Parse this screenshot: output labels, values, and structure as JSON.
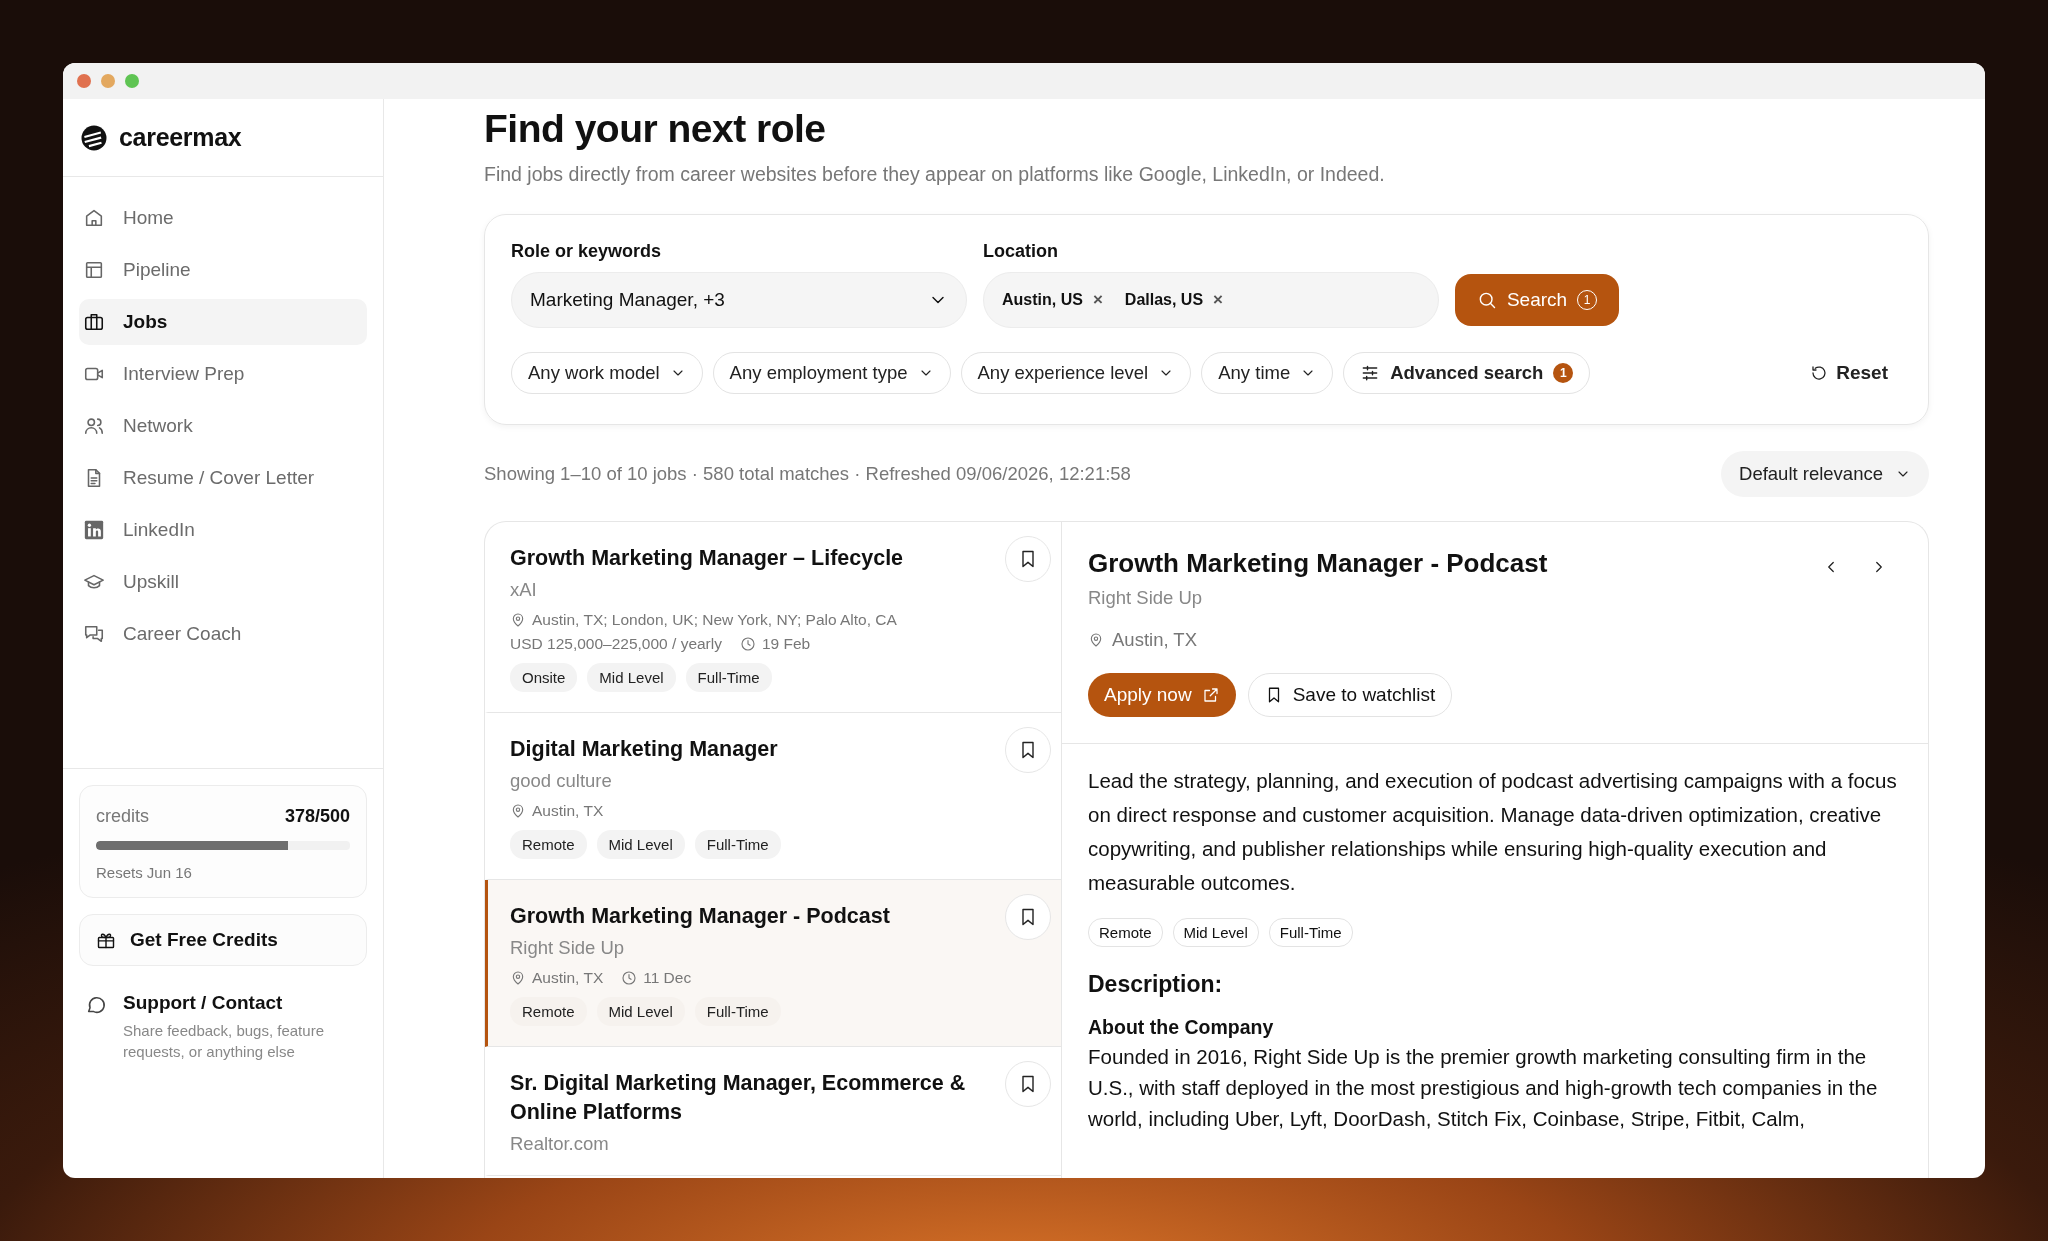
{
  "app": {
    "name": "careermax"
  },
  "nav": [
    {
      "label": "Home",
      "selected": false
    },
    {
      "label": "Pipeline",
      "selected": false
    },
    {
      "label": "Jobs",
      "selected": true
    },
    {
      "label": "Interview Prep",
      "selected": false
    },
    {
      "label": "Network",
      "selected": false
    },
    {
      "label": "Resume / Cover Letter",
      "selected": false
    },
    {
      "label": "LinkedIn",
      "selected": false
    },
    {
      "label": "Upskill",
      "selected": false
    },
    {
      "label": "Career Coach",
      "selected": false
    }
  ],
  "credits": {
    "label": "credits",
    "value": "378/500",
    "level": 0.756,
    "reset": "Resets Jun 16"
  },
  "free_credits": "Get Free Credits",
  "support": {
    "title": "Support / Contact",
    "text": "Share feedback, bugs, feature requests, or anything else"
  },
  "page": {
    "title": "Find your next role",
    "subtitle": "Find jobs directly from career websites before they appear on platforms like Google, LinkedIn, or Indeed."
  },
  "search": {
    "role_label": "Role or keywords",
    "role_value": "Marketing Manager, +3",
    "location_label": "Location",
    "locations": [
      {
        "label": "Austin, US",
        "remove": "×"
      },
      {
        "label": "Dallas, US",
        "remove": "×"
      }
    ],
    "button": "Search",
    "button_badge": "1"
  },
  "filters": [
    "Any work model",
    "Any employment type",
    "Any experience level",
    "Any time"
  ],
  "advanced": {
    "label": "Advanced search",
    "count": "1"
  },
  "reset": "Reset",
  "results": {
    "summary": "Showing 1–10 of 10 jobs · 580 total matches · Refreshed 09/06/2026, 12:21:58",
    "sort": "Default relevance"
  },
  "jobs": [
    {
      "title": "Growth Marketing Manager – Lifecycle",
      "company": "xAI",
      "location": "Austin, TX; London, UK; New York, NY; Palo Alto, CA",
      "salary": "USD 125,000–225,000 / yearly",
      "date": "19 Feb",
      "tags": [
        "Onsite",
        "Mid Level",
        "Full-Time"
      ],
      "selected": false
    },
    {
      "title": "Digital Marketing Manager",
      "company": "good culture",
      "location": "Austin, TX",
      "tags": [
        "Remote",
        "Mid Level",
        "Full-Time"
      ],
      "selected": false
    },
    {
      "title": "Growth Marketing Manager - Podcast",
      "company": "Right Side Up",
      "location": "Austin, TX",
      "date": "11 Dec",
      "tags": [
        "Remote",
        "Mid Level",
        "Full-Time"
      ],
      "selected": true
    },
    {
      "title": "Sr. Digital Marketing Manager, Ecommerce & Online Platforms",
      "company": "Realtor.com",
      "selected": false
    }
  ],
  "detail": {
    "title": "Growth Marketing Manager - Podcast",
    "company": "Right Side Up",
    "location": "Austin, TX",
    "apply": "Apply now",
    "save": "Save to watchlist",
    "summary": "Lead the strategy, planning, and execution of podcast advertising campaigns with a focus on direct response and customer acquisition. Manage data-driven optimization, creative copywriting, and publisher relationships while ensuring high-quality execution and measurable outcomes.",
    "tags": [
      "Remote",
      "Mid Level",
      "Full-Time"
    ],
    "description_heading": "Description:",
    "about_heading": "About the Company",
    "about_text": "Founded in 2016, Right Side Up is the premier growth marketing consulting firm in the U.S., with staff deployed in the most prestigious and high-growth tech companies in the world, including Uber, Lyft, DoorDash, Stitch Fix, Coinbase, Stripe, Fitbit, Calm,"
  }
}
